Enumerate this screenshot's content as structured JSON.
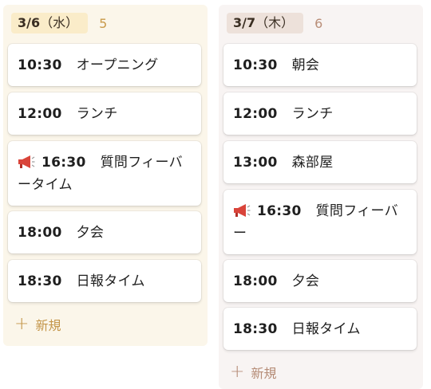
{
  "columns": [
    {
      "date": "3/6",
      "weekday": "（水）",
      "count": "5",
      "cards": [
        {
          "time": "10:30",
          "title": "オープニング",
          "icon": ""
        },
        {
          "time": "12:00",
          "title": "ランチ",
          "icon": ""
        },
        {
          "time": "16:30",
          "title": "質問フィーバータイム",
          "icon": "megaphone-icon"
        },
        {
          "time": "18:00",
          "title": "夕会",
          "icon": ""
        },
        {
          "time": "18:30",
          "title": "日報タイム",
          "icon": ""
        }
      ],
      "new_label": "新規"
    },
    {
      "date": "3/7",
      "weekday": "（木）",
      "count": "6",
      "cards": [
        {
          "time": "10:30",
          "title": "朝会",
          "icon": ""
        },
        {
          "time": "12:00",
          "title": "ランチ",
          "icon": ""
        },
        {
          "time": "13:00",
          "title": "森部屋",
          "icon": ""
        },
        {
          "time": "16:30",
          "title": "質問フィーバー",
          "icon": "megaphone-icon"
        },
        {
          "time": "18:00",
          "title": "夕会",
          "icon": ""
        },
        {
          "time": "18:30",
          "title": "日報タイム",
          "icon": ""
        }
      ],
      "new_label": "新規"
    }
  ],
  "colors": {
    "col_a_bg": "#fbf6ea",
    "col_b_bg": "#f8f4f3",
    "megaphone": "#d9443a"
  }
}
